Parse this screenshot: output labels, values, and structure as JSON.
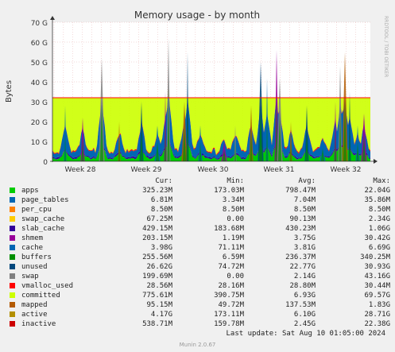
{
  "chart_data": {
    "type": "area",
    "title": "Memory usage - by month",
    "ylabel": "Bytes",
    "ylim": [
      0,
      70
    ],
    "y_unit": "G",
    "y_ticks": [
      "0",
      "10 G",
      "20 G",
      "30 G",
      "40 G",
      "50 G",
      "60 G",
      "70 G"
    ],
    "x_ticks": [
      "Week 28",
      "Week 29",
      "Week 30",
      "Week 31",
      "Week 32"
    ],
    "grid": true,
    "stacked": true,
    "side_label": "RRDTOOL / TOBI OETIKER",
    "reference_line_value": 32.0,
    "colors": {
      "background": "#f0f0f0",
      "plot_background": "#ffffff",
      "grid": "#e0b0b0",
      "unused_fill": "#ccff00",
      "reference_line": "#ff0000"
    },
    "series": [
      {
        "name": "apps",
        "color": "#00cc00",
        "cur": "325.23M",
        "min": "173.03M",
        "avg": "798.47M",
        "max": "22.04G"
      },
      {
        "name": "page_tables",
        "color": "#0066b3",
        "cur": "6.81M",
        "min": "3.34M",
        "avg": "7.04M",
        "max": "35.86M"
      },
      {
        "name": "per_cpu",
        "color": "#ff8000",
        "cur": "8.50M",
        "min": "8.50M",
        "avg": "8.50M",
        "max": "8.50M"
      },
      {
        "name": "swap_cache",
        "color": "#ffcc00",
        "cur": "67.25M",
        "min": "0.00",
        "avg": "90.13M",
        "max": "2.34G"
      },
      {
        "name": "slab_cache",
        "color": "#330099",
        "cur": "429.15M",
        "min": "183.68M",
        "avg": "430.23M",
        "max": "1.06G"
      },
      {
        "name": "shmem",
        "color": "#990099",
        "cur": "203.15M",
        "min": "1.19M",
        "avg": "3.75G",
        "max": "30.42G"
      },
      {
        "name": "cache",
        "color": "#ccff00",
        "cur": "3.98G",
        "min": "71.11M",
        "avg": "3.81G",
        "max": "6.69G"
      },
      {
        "name": "buffers",
        "color": "#ff0000",
        "cur": "255.56M",
        "min": "6.59M",
        "avg": "236.37M",
        "max": "340.25M"
      },
      {
        "name": "unused",
        "color": "#808080",
        "cur": "26.62G",
        "min": "74.72M",
        "avg": "22.77G",
        "max": "30.93G"
      },
      {
        "name": "swap",
        "color": "#008f00",
        "cur": "199.69M",
        "min": "0.00",
        "avg": "2.14G",
        "max": "43.16G"
      },
      {
        "name": "vmalloc_used",
        "color": "#00487d",
        "cur": "28.56M",
        "min": "28.16M",
        "avg": "28.80M",
        "max": "30.44M"
      },
      {
        "name": "committed",
        "color": "#b35a00",
        "cur": "775.61M",
        "min": "390.75M",
        "avg": "6.93G",
        "max": "69.57G"
      },
      {
        "name": "mapped",
        "color": "#b38f00",
        "cur": "95.15M",
        "min": "49.72M",
        "avg": "137.53M",
        "max": "1.83G"
      },
      {
        "name": "active",
        "color": "#6b006b",
        "cur": "4.17G",
        "min": "173.11M",
        "avg": "6.10G",
        "max": "28.71G"
      },
      {
        "name": "inactive",
        "color": "#8fb300",
        "cur": "538.71M",
        "min": "159.78M",
        "avg": "2.45G",
        "max": "22.38G"
      }
    ],
    "legend_columns": {
      "cur": "Cur:",
      "min": "Min:",
      "avg": "Avg:",
      "max": "Max:"
    }
  },
  "legend_colors_display": [
    "#00cc00",
    "#0066b3",
    "#ff8000",
    "#ffcc00",
    "#330099",
    "#990099",
    "#0066b3",
    "#008f00",
    "#00487d",
    "#808080",
    "#ff0000",
    "#ccff00",
    "#b35a00",
    "#b38f00",
    "#cc0000"
  ],
  "footer": {
    "last_update": "Last update: Sat Aug 10 01:05:00 2024",
    "munin_version": "Munin 2.0.67"
  }
}
